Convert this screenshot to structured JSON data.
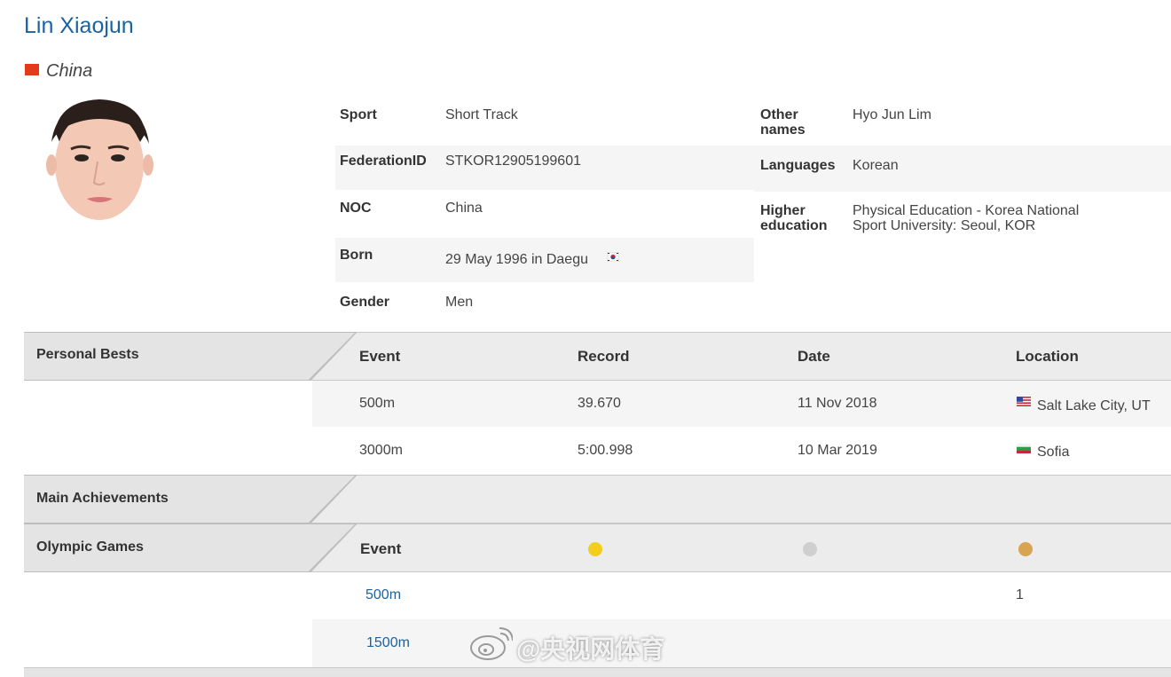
{
  "athlete": {
    "name": "Lin Xiaojun",
    "country": "China"
  },
  "info": {
    "sport_label": "Sport",
    "sport": "Short Track",
    "federation_label": "FederationID",
    "federation": "STKOR12905199601",
    "noc_label": "NOC",
    "noc": "China",
    "born_label": "Born",
    "born": "29 May 1996 in Daegu",
    "gender_label": "Gender",
    "gender": "Men",
    "other_names_label_1": "Other",
    "other_names_label_2": "names",
    "other_names": "Hyo Jun Lim",
    "languages_label": "Languages",
    "languages": "Korean",
    "education_label_1": "Higher",
    "education_label_2": "education",
    "education_1": "Physical Education - Korea National",
    "education_2": "Sport University: Seoul, KOR"
  },
  "personal_bests": {
    "title": "Personal Bests",
    "headers": {
      "event": "Event",
      "record": "Record",
      "date": "Date",
      "location": "Location"
    },
    "rows": [
      {
        "event": "500m",
        "record": "39.670",
        "date": "11 Nov 2018",
        "location": "Salt Lake City, UT",
        "flag": "us-flag-icon"
      },
      {
        "event": "3000m",
        "record": "5:00.998",
        "date": "10 Mar 2019",
        "location": "Sofia",
        "flag": "bulgaria-flag-icon"
      }
    ]
  },
  "main_achievements": {
    "title": "Main Achievements"
  },
  "olympic_games": {
    "title": "Olympic Games",
    "headers": {
      "event": "Event"
    },
    "medal_colors": {
      "gold": "#f2cf1f",
      "silver": "#cfcfcf",
      "bronze": "#d8a452"
    },
    "rows": [
      {
        "event": "500m",
        "bronze": "1"
      },
      {
        "event": "1500m"
      }
    ]
  },
  "watermark": {
    "text": "@央视网体育"
  },
  "colors": {
    "link": "#1b63a0",
    "flag_china": "#e23a1c"
  }
}
